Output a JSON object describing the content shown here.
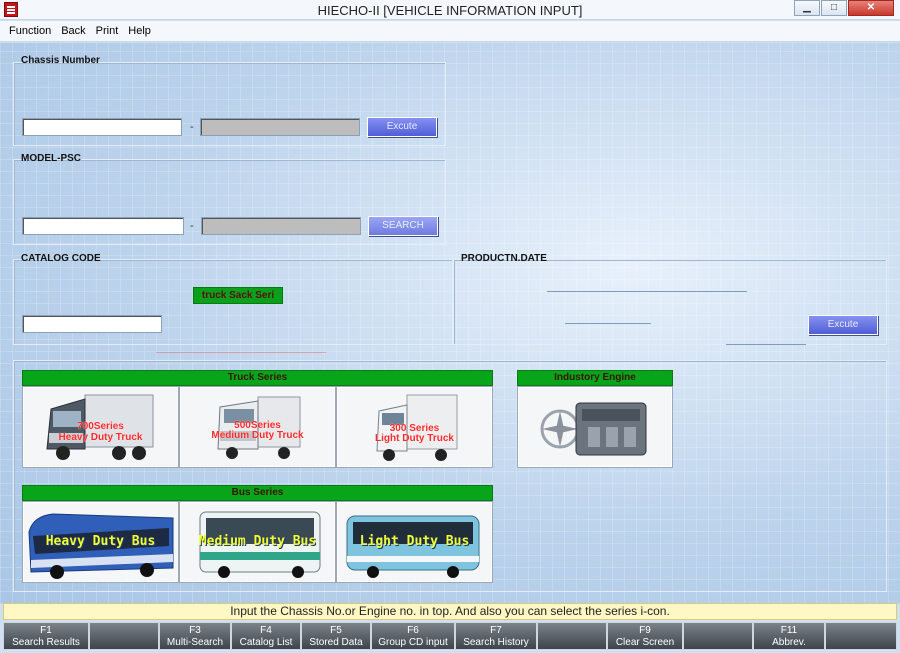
{
  "window": {
    "title": "HIECHO-II [VEHICLE INFORMATION INPUT]",
    "minimize": "▁",
    "maximize": "□",
    "close": "✕"
  },
  "menu": [
    "Function",
    "Back",
    "Print",
    "Help"
  ],
  "chassis": {
    "label": "Chassis Number",
    "dash": "-",
    "button": "Excute"
  },
  "model": {
    "label": "MODEL-PSC",
    "dash": "-",
    "button": "SEARCH"
  },
  "catalog": {
    "label": "CATALOG CODE",
    "chip": "truck Sack Seri"
  },
  "production": {
    "label": "PRODUCTN.DATE",
    "button": "Excute"
  },
  "truck_series": {
    "header": "Truck Series",
    "tiles": [
      {
        "label1": "700Series",
        "label2": "Heavy Duty Truck"
      },
      {
        "label1": "500Series",
        "label2": "Medium Duty Truck"
      },
      {
        "label1": "300 Series",
        "label2": "Light Duty Truck"
      }
    ]
  },
  "engine": {
    "header": "Industory Engine"
  },
  "bus_series": {
    "header": "Bus Series",
    "tiles": [
      {
        "label": "Heavy Duty Bus"
      },
      {
        "label": "Medium Duty Bus"
      },
      {
        "label": "Light Duty Bus"
      }
    ]
  },
  "status": "Input the Chassis No.or Engine no. in top. And also you can select the series i-con.",
  "fkeys": [
    {
      "key": "F1",
      "label": "Search Results"
    },
    {
      "key": "",
      "label": ""
    },
    {
      "key": "F3",
      "label": "Multi-Search"
    },
    {
      "key": "F4",
      "label": "Catalog List"
    },
    {
      "key": "F5",
      "label": "Stored Data"
    },
    {
      "key": "F6",
      "label": "Group CD input"
    },
    {
      "key": "F7",
      "label": "Search History"
    },
    {
      "key": "",
      "label": ""
    },
    {
      "key": "F9",
      "label": "Clear Screen"
    },
    {
      "key": "",
      "label": ""
    },
    {
      "key": "F11",
      "label": "Abbrev."
    },
    {
      "key": "",
      "label": ""
    }
  ]
}
